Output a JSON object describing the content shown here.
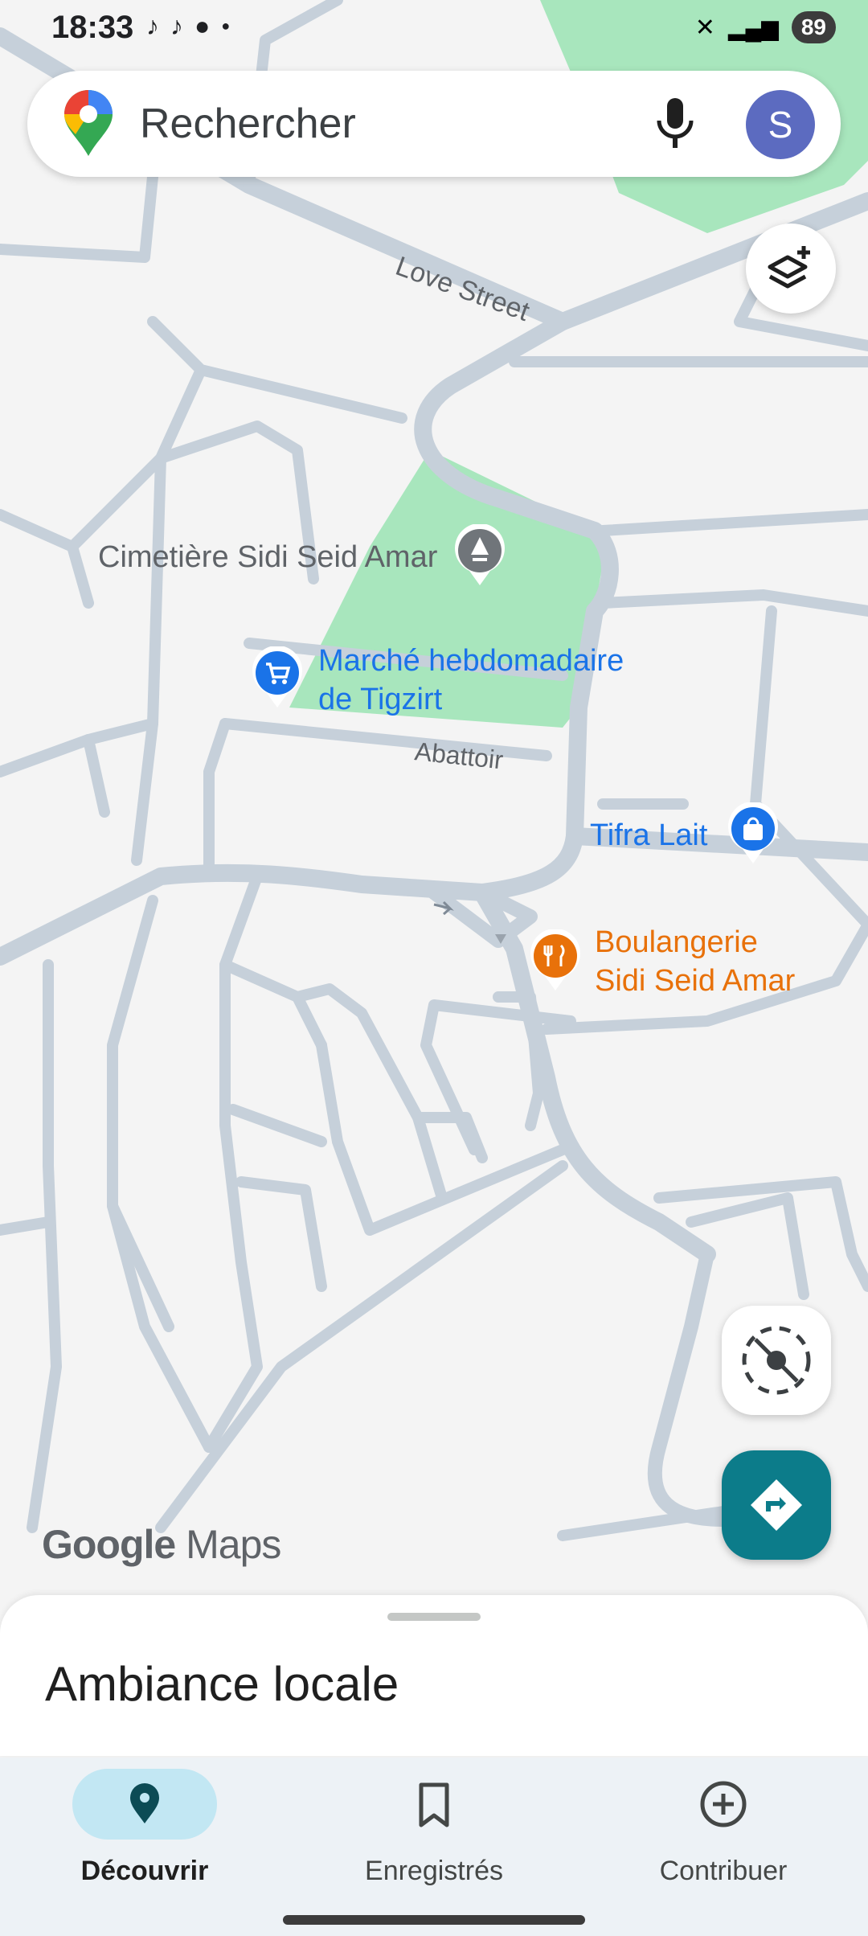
{
  "status": {
    "time": "18:33",
    "battery": "89"
  },
  "search": {
    "placeholder": "Rechercher",
    "avatar_letter": "S"
  },
  "map": {
    "streets": {
      "love_street": "Love Street",
      "abattoir": "Abattoir"
    },
    "places": {
      "cemetery": "Cimetière Sidi Seid Amar",
      "market_line1": "Marché hebdomadaire",
      "market_line2": "de Tigzirt",
      "tifra": "Tifra Lait",
      "bakery_line1": "Boulangerie",
      "bakery_line2": "Sidi Seid Amar"
    },
    "watermark": {
      "google": "Google",
      "maps": "Maps"
    }
  },
  "sheet": {
    "title": "Ambiance locale"
  },
  "nav": {
    "items": [
      {
        "label": "Découvrir",
        "icon": "pin-icon",
        "active": true
      },
      {
        "label": "Enregistrés",
        "icon": "bookmark-icon",
        "active": false
      },
      {
        "label": "Contribuer",
        "icon": "add-circle-icon",
        "active": false
      }
    ]
  },
  "colors": {
    "accent": "#0c7c8a",
    "park": "#a8e6bd",
    "road": "#c6d0da",
    "poi_blue": "#1a73e8",
    "poi_orange": "#e8710a"
  }
}
